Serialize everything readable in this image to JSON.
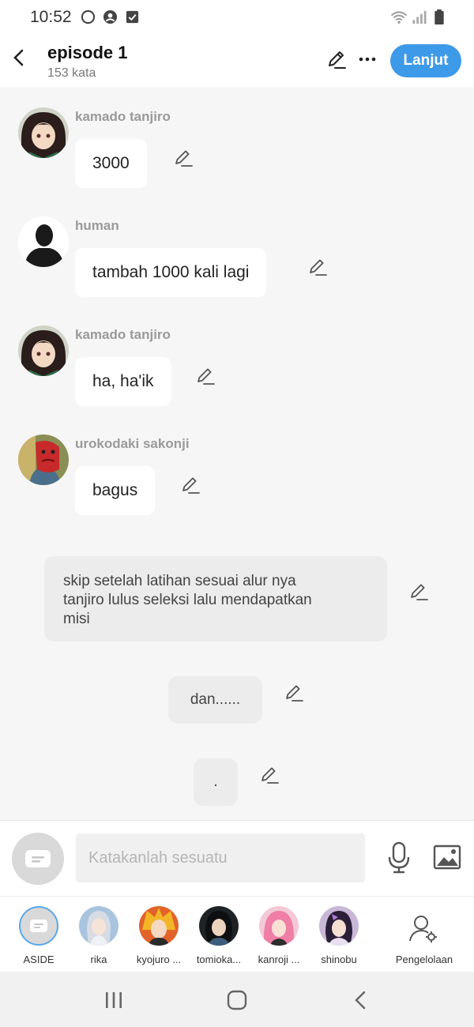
{
  "status": {
    "time": "10:52"
  },
  "header": {
    "title": "episode 1",
    "word_count": "153 kata",
    "next_label": "Lanjut"
  },
  "messages": [
    {
      "sender": "kamado tanjiro",
      "text": "3000"
    },
    {
      "sender": "human",
      "text": "tambah 1000 kali lagi"
    },
    {
      "sender": "kamado tanjiro",
      "text": "ha, ha'ik"
    },
    {
      "sender": "urokodaki sakonji",
      "text": "bagus"
    }
  ],
  "narrations": [
    {
      "lines": [
        "skip setelah latihan sesuai alur nya",
        "tanjiro lulus seleksi lalu mendapatkan",
        "misi"
      ]
    },
    {
      "text": "dan......"
    },
    {
      "text": "."
    }
  ],
  "input": {
    "placeholder": "Katakanlah sesuatu"
  },
  "characters": [
    {
      "name": "ASIDE"
    },
    {
      "name": "rika"
    },
    {
      "name": "kyojuro ..."
    },
    {
      "name": "tomioka..."
    },
    {
      "name": "kanroji ..."
    },
    {
      "name": "shinobu"
    },
    {
      "name": "Pengelolaan"
    }
  ],
  "colors": {
    "accent": "#3d9ae8",
    "background": "#f6f6f6",
    "bubble": "#ffffff",
    "narration": "#ececec"
  }
}
